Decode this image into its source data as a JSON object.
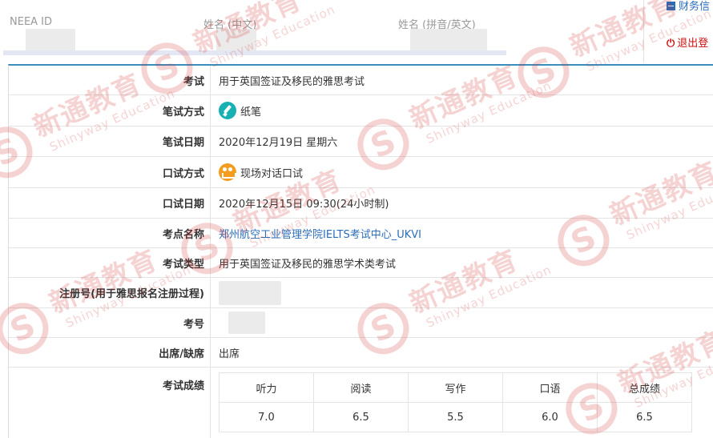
{
  "header": {
    "neea_id_label": "NEEA ID",
    "name_cn_label": "姓名 (中文)",
    "name_en_label": "姓名 (拼音/英文)"
  },
  "side": {
    "finance_label": "财务信",
    "logout_icon": "power-icon",
    "logout_label": "退出登"
  },
  "rows": [
    {
      "label": "考试",
      "value": "用于英国签证及移民的雅思考试"
    },
    {
      "label": "笔试方式",
      "value": "纸笔",
      "icon": "pencil-icon"
    },
    {
      "label": "笔试日期",
      "value": "2020年12月19日 星期六"
    },
    {
      "label": "口试方式",
      "value": "现场对话口试",
      "icon": "talk-icon"
    },
    {
      "label": "口试日期",
      "value": "2020年12月15日 09:30(24小时制)"
    },
    {
      "label": "考点名称",
      "value": "郑州航空工业管理学院IELTS考试中心_UKVI"
    },
    {
      "label": "考试类型",
      "value": "用于英国签证及移民的雅思学术类考试"
    },
    {
      "label": "注册号(用于雅思报名注册过程)",
      "value": ""
    },
    {
      "label": "考号",
      "value": ""
    },
    {
      "label": "出席/缺席",
      "value": "出席"
    },
    {
      "label": "考试成绩",
      "value": ""
    }
  ],
  "scores": {
    "headers": [
      "听力",
      "阅读",
      "写作",
      "口语",
      "总成绩"
    ],
    "values": [
      "7.0",
      "6.5",
      "5.5",
      "6.0",
      "6.5"
    ]
  },
  "watermark": {
    "cn": "新通教育",
    "en": "Shinyway Education",
    "color": "#d62b2b"
  },
  "colors": {
    "accent": "#3c8dbc",
    "link": "#2a6ebb",
    "danger": "#cc1111"
  }
}
